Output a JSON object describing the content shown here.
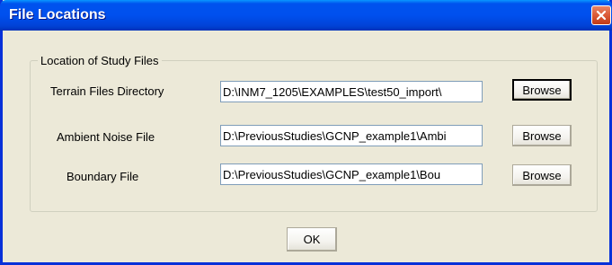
{
  "window": {
    "title": "File Locations"
  },
  "group": {
    "legend": "Location of Study Files"
  },
  "rows": [
    {
      "label": "Terrain Files Directory",
      "value": "D:\\INM7_1205\\EXAMPLES\\test50_import\\",
      "button": "Browse"
    },
    {
      "label": "Ambient Noise File",
      "value": "D:\\PreviousStudies\\GCNP_example1\\Ambi",
      "button": "Browse"
    },
    {
      "label": "Boundary File",
      "value": "D:\\PreviousStudies\\GCNP_example1\\Bou",
      "button": "Browse"
    }
  ],
  "footer": {
    "ok_label": "OK"
  },
  "colors": {
    "titlebar": "#0053EE",
    "close_button": "#DB5A37",
    "dialog_bg": "#ECE9D8"
  }
}
